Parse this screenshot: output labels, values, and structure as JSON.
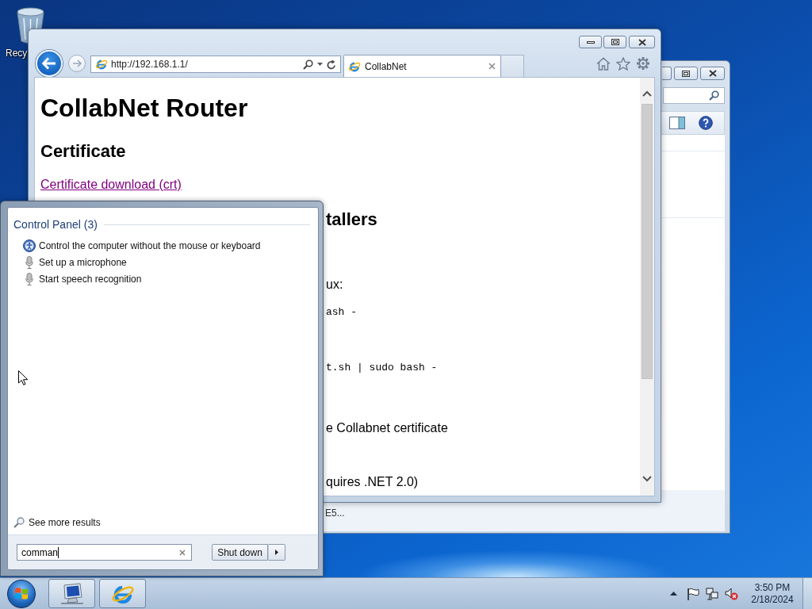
{
  "desktop": {
    "icons": [
      {
        "label": "Recy"
      }
    ]
  },
  "back_window": {
    "status_text": "E5..."
  },
  "browser": {
    "address": "http://192.168.1.1/",
    "tabs": [
      {
        "title": "CollabNet",
        "selected": true
      }
    ],
    "page": {
      "title": "CollabNet Router",
      "sections": [
        {
          "heading": "Certificate",
          "lines": [
            {
              "kind": "link",
              "text": "Certificate download (crt)"
            }
          ]
        },
        {
          "heading": "tallers",
          "lines": [
            {
              "kind": "text",
              "text": "ux:"
            },
            {
              "kind": "code",
              "text": "ash -"
            },
            {
              "kind": "code",
              "text": "t.sh | sudo bash -"
            },
            {
              "kind": "text",
              "text": "e Collabnet certificate"
            },
            {
              "kind": "text",
              "text": "quires .NET 2.0)"
            }
          ]
        }
      ]
    }
  },
  "start_menu": {
    "groups": [
      {
        "title": "Control Panel (3)",
        "items": [
          {
            "kind": "access",
            "label": "Control the computer without the mouse or keyboard"
          },
          {
            "kind": "microphone",
            "label": "Set up a microphone"
          },
          {
            "kind": "microphone",
            "label": "Start speech recognition"
          }
        ]
      }
    ],
    "see_more": "See more results",
    "search": {
      "value": "comman"
    },
    "power_button": "Shut down"
  },
  "taskbar": {
    "clock": {
      "time": "3:50 PM",
      "date": "2/18/2024"
    }
  }
}
